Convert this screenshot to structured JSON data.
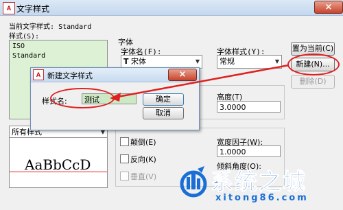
{
  "window": {
    "title": "文字样式",
    "app_icon_text": "A",
    "close_symbol": "×",
    "current_style_label": "当前文字样式:",
    "current_style_value": "Standard"
  },
  "styles": {
    "label": "样式(S):",
    "items": [
      "ISO",
      "Standard"
    ],
    "filter_value": "所有样式"
  },
  "font": {
    "group_label": "字体",
    "name_label": "字体名(F):",
    "name_value": "宋体",
    "name_icon": "T",
    "style_label": "字体样式(Y):",
    "style_value": "常规"
  },
  "size": {
    "height_label": "高度(T)",
    "height_value": "3.0000"
  },
  "effects": {
    "upside_down_label": "颠倒(E)",
    "backwards_label": "反向(K)",
    "vertical_label": "垂直(V)",
    "width_factor_label": "宽度因子(W):",
    "width_factor_value": "1.0000",
    "oblique_label": "倾斜角度(O):"
  },
  "buttons": {
    "set_current": "置为当前(C)",
    "new": "新建(N)...",
    "delete": "删除(D)"
  },
  "preview": {
    "sample_text": "AaBbCcD"
  },
  "new_style_dialog": {
    "title": "新建文字样式",
    "app_icon_text": "A",
    "close_symbol": "×",
    "name_label": "样式名:",
    "name_value": "测试",
    "ok": "确定",
    "cancel": "取消"
  },
  "watermark": {
    "brand": "系统之城",
    "url": "xitong86.com"
  },
  "colors": {
    "annotation_red": "#e02020",
    "selection_green": "#ddf1d4",
    "watermark_blue": "#1a6fd6"
  }
}
